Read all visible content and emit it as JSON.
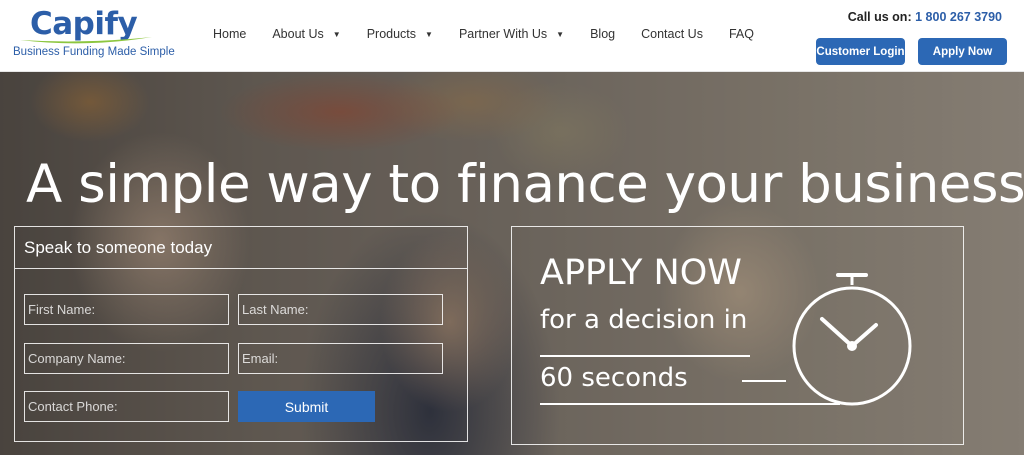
{
  "brand": {
    "name": "Capify",
    "tagline": "Business Funding Made Simple",
    "primary_color": "#2c68b5"
  },
  "nav": {
    "items": [
      {
        "label": "Home",
        "has_dropdown": false
      },
      {
        "label": "About Us",
        "has_dropdown": true
      },
      {
        "label": "Products",
        "has_dropdown": true
      },
      {
        "label": "Partner With Us",
        "has_dropdown": true
      },
      {
        "label": "Blog",
        "has_dropdown": false
      },
      {
        "label": "Contact Us",
        "has_dropdown": false
      },
      {
        "label": "FAQ",
        "has_dropdown": false
      }
    ]
  },
  "contact": {
    "call_label": "Call us on:",
    "phone": "1 800 267 3790"
  },
  "header_buttons": {
    "login": "Customer Login",
    "apply": "Apply Now"
  },
  "hero": {
    "headline": "A simple way to finance your business"
  },
  "form": {
    "title": "Speak to someone today",
    "first_name_placeholder": "First Name:",
    "last_name_placeholder": "Last Name:",
    "company_placeholder": "Company Name:",
    "email_placeholder": "Email:",
    "phone_placeholder": "Contact Phone:",
    "submit_label": "Submit"
  },
  "promo": {
    "line1": "APPLY NOW",
    "line2": "for a decision in",
    "line3": "60 seconds",
    "icon": "stopwatch-icon"
  }
}
